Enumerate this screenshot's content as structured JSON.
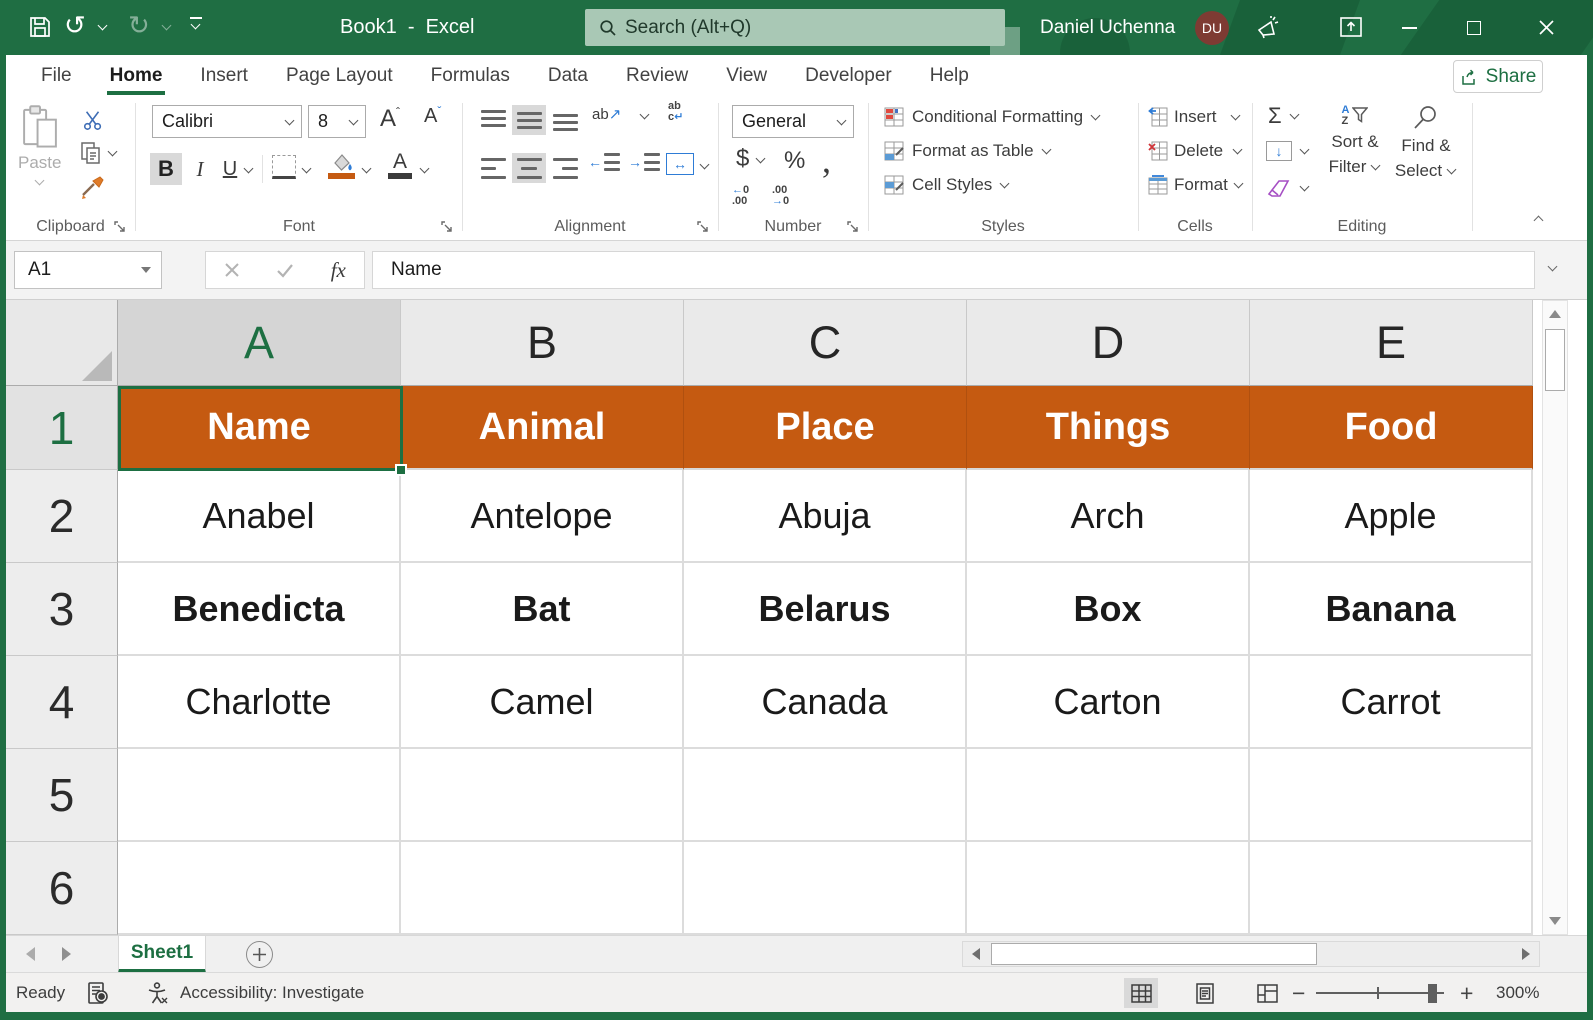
{
  "colors": {
    "title_bar_green": "#1F6E43",
    "accent_green": "#1D6F42",
    "header_fill_orange": "#C55A11",
    "search_box": "#A9C8B5",
    "avatar_bg": "#7E3B33"
  },
  "title_bar": {
    "title": "Book1  -  Excel",
    "search_placeholder": "Search (Alt+Q)",
    "user_name": "Daniel Uchenna",
    "user_initials": "DU"
  },
  "tabs": {
    "items": [
      "File",
      "Home",
      "Insert",
      "Page Layout",
      "Formulas",
      "Data",
      "Review",
      "View",
      "Developer",
      "Help"
    ],
    "active": "Home",
    "share": "Share"
  },
  "ribbon": {
    "clipboard": {
      "label": "Clipboard",
      "paste": "Paste"
    },
    "font": {
      "label": "Font",
      "name": "Calibri",
      "size": "8"
    },
    "alignment": {
      "label": "Alignment"
    },
    "number": {
      "label": "Number",
      "format": "General"
    },
    "styles": {
      "label": "Styles",
      "conditional": "Conditional Formatting",
      "format_table": "Format as Table",
      "cell_styles": "Cell Styles"
    },
    "cells": {
      "label": "Cells",
      "insert": "Insert",
      "delete": "Delete",
      "format": "Format"
    },
    "editing": {
      "label": "Editing",
      "sort_line1": "Sort &",
      "sort_line2": "Filter",
      "find_line1": "Find &",
      "find_line2": "Select"
    }
  },
  "formula_bar": {
    "name_box": "A1",
    "fx": "fx",
    "content": "Name"
  },
  "grid": {
    "columns": [
      "A",
      "B",
      "C",
      "D",
      "E"
    ],
    "row_numbers": [
      "1",
      "2",
      "3",
      "4",
      "5",
      "6"
    ],
    "selected_cell": "A1"
  },
  "sheet": {
    "header_row": [
      "Name",
      "Animal",
      "Place",
      "Things",
      "Food"
    ],
    "data_rows": [
      [
        "Anabel",
        "Antelope",
        "Abuja",
        "Arch",
        "Apple"
      ],
      [
        "Benedicta",
        "Bat",
        "Belarus",
        "Box",
        "Banana"
      ],
      [
        "Charlotte",
        "Camel",
        "Canada",
        "Carton",
        "Carrot"
      ]
    ]
  },
  "sheet_bar": {
    "active_tab": "Sheet1"
  },
  "status_bar": {
    "mode": "Ready",
    "accessibility": "Accessibility: Investigate",
    "zoom_level": "300%"
  }
}
